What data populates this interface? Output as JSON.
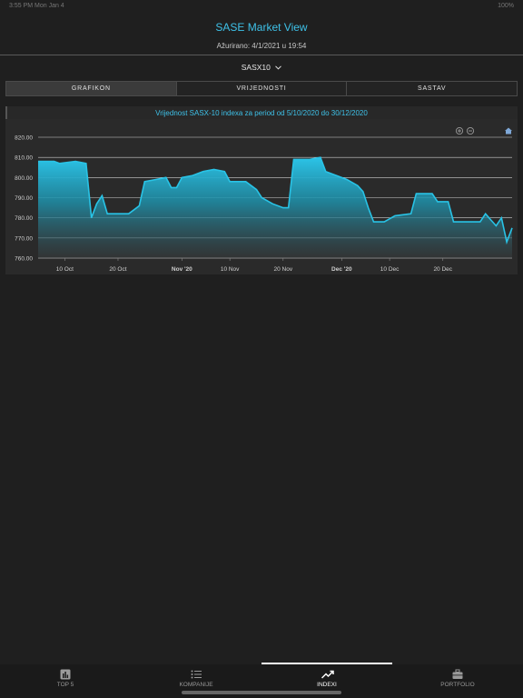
{
  "status_bar": {
    "left": "3:55 PM  Mon Jan 4",
    "right": "100%"
  },
  "header": {
    "title": "SASE Market View",
    "updated": "Ažurirano: 4/1/2021 u 19:54",
    "index_label": "SASX10",
    "index_chevron": "chevron-down-icon"
  },
  "segments": [
    {
      "label": "GRAFIKON",
      "active": true
    },
    {
      "label": "VRIJEDNOSTI",
      "active": false
    },
    {
      "label": "SASTAV",
      "active": false
    }
  ],
  "chart_data": {
    "type": "area",
    "title": "Vrijednost SASX-10 indexa za period od 5/10/2020 do 30/12/2020",
    "x_start": "2020-10-05",
    "x_end": "2020-12-30",
    "ylim": [
      760,
      820
    ],
    "y_ticks": [
      "760.00",
      "770.00",
      "780.00",
      "790.00",
      "800.00",
      "810.00",
      "820.00"
    ],
    "x_ticks": [
      {
        "date": "2020-10-10",
        "label": "10 Oct",
        "bold": false
      },
      {
        "date": "2020-10-20",
        "label": "20 Oct",
        "bold": false
      },
      {
        "date": "2020-11-01",
        "label": "Nov '20",
        "bold": true
      },
      {
        "date": "2020-11-10",
        "label": "10 Nov",
        "bold": false
      },
      {
        "date": "2020-11-20",
        "label": "20 Nov",
        "bold": false
      },
      {
        "date": "2020-12-01",
        "label": "Dec '20",
        "bold": true
      },
      {
        "date": "2020-12-10",
        "label": "10 Dec",
        "bold": false
      },
      {
        "date": "2020-12-20",
        "label": "20 Dec",
        "bold": false
      }
    ],
    "grid": true,
    "line_color": "#29c3e6",
    "points": [
      [
        "2020-10-05",
        808
      ],
      [
        "2020-10-08",
        808
      ],
      [
        "2020-10-09",
        807
      ],
      [
        "2020-10-12",
        808
      ],
      [
        "2020-10-14",
        807
      ],
      [
        "2020-10-15",
        780
      ],
      [
        "2020-10-16",
        787
      ],
      [
        "2020-10-17",
        791
      ],
      [
        "2020-10-18",
        782
      ],
      [
        "2020-10-20",
        782
      ],
      [
        "2020-10-22",
        782
      ],
      [
        "2020-10-23",
        784
      ],
      [
        "2020-10-24",
        786
      ],
      [
        "2020-10-25",
        798
      ],
      [
        "2020-10-27",
        799
      ],
      [
        "2020-10-29",
        800
      ],
      [
        "2020-10-30",
        795
      ],
      [
        "2020-10-31",
        795
      ],
      [
        "2020-11-01",
        800
      ],
      [
        "2020-11-03",
        801
      ],
      [
        "2020-11-05",
        803
      ],
      [
        "2020-11-07",
        804
      ],
      [
        "2020-11-09",
        803
      ],
      [
        "2020-11-10",
        798
      ],
      [
        "2020-11-13",
        798
      ],
      [
        "2020-11-15",
        794
      ],
      [
        "2020-11-16",
        790
      ],
      [
        "2020-11-18",
        787
      ],
      [
        "2020-11-20",
        785
      ],
      [
        "2020-11-21",
        785
      ],
      [
        "2020-11-22",
        809
      ],
      [
        "2020-11-25",
        809
      ],
      [
        "2020-11-27",
        810
      ],
      [
        "2020-11-28",
        803
      ],
      [
        "2020-11-30",
        801
      ],
      [
        "2020-12-02",
        799
      ],
      [
        "2020-12-04",
        796
      ],
      [
        "2020-12-05",
        793
      ],
      [
        "2020-12-06",
        785
      ],
      [
        "2020-12-07",
        778
      ],
      [
        "2020-12-09",
        778
      ],
      [
        "2020-12-11",
        781
      ],
      [
        "2020-12-14",
        782
      ],
      [
        "2020-12-15",
        792
      ],
      [
        "2020-12-18",
        792
      ],
      [
        "2020-12-19",
        788
      ],
      [
        "2020-12-21",
        788
      ],
      [
        "2020-12-22",
        778
      ],
      [
        "2020-12-24",
        778
      ],
      [
        "2020-12-27",
        778
      ],
      [
        "2020-12-28",
        782
      ],
      [
        "2020-12-29",
        779
      ],
      [
        "2020-12-30",
        776
      ],
      [
        "2020-12-31",
        780
      ],
      [
        "2021-01-01",
        768
      ],
      [
        "2021-01-02",
        775
      ]
    ],
    "controls": [
      "zoom-in-icon",
      "zoom-out-icon",
      "home-icon"
    ]
  },
  "tabs": [
    {
      "label": "TOP 5",
      "icon": "bar-chart-icon",
      "active": false
    },
    {
      "label": "KOMPANIJE",
      "icon": "list-icon",
      "active": false
    },
    {
      "label": "INDEXI",
      "icon": "trend-icon",
      "active": true
    },
    {
      "label": "PORTFOLIO",
      "icon": "briefcase-icon",
      "active": false
    }
  ]
}
